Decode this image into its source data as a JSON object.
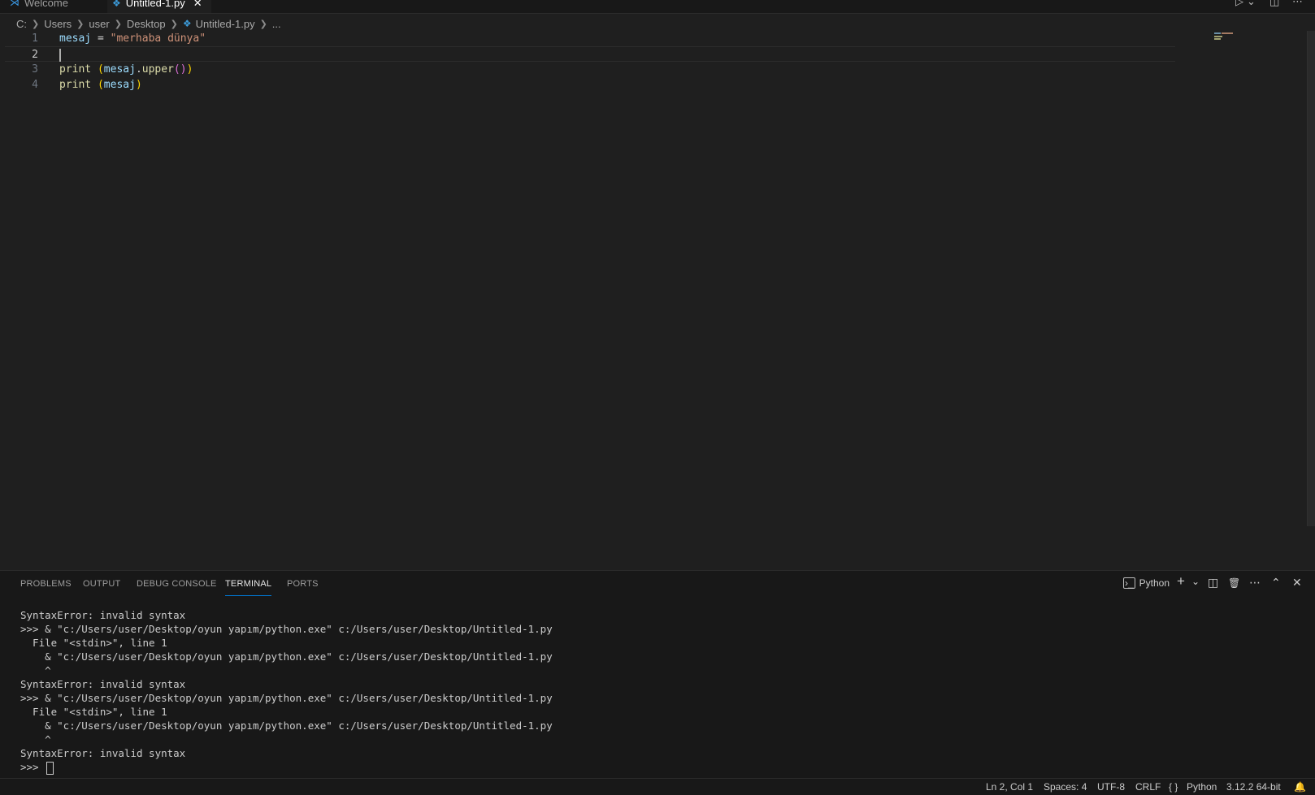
{
  "tabs": [
    {
      "label": "Welcome",
      "icon": "vscode-logo-icon"
    },
    {
      "label": "Untitled-1.py",
      "icon": "python-file-icon",
      "active": true,
      "close": "✕"
    }
  ],
  "titlebar_actions": {
    "run": "▷",
    "run_menu": "⌄",
    "split": "◫",
    "more": "⋯"
  },
  "breadcrumb": [
    "C:",
    "Users",
    "user",
    "Desktop",
    "Untitled-1.py",
    "..."
  ],
  "editor": {
    "lines": [
      {
        "num": "1",
        "tokens": [
          [
            "v",
            "mesaj"
          ],
          [
            "op",
            " = "
          ],
          [
            "s",
            "\"merhaba dünya\""
          ]
        ]
      },
      {
        "num": "2",
        "tokens": []
      },
      {
        "num": "3",
        "tokens": [
          [
            "f",
            "print"
          ],
          [
            "op",
            " "
          ],
          [
            "p1",
            "("
          ],
          [
            "v",
            "mesaj"
          ],
          [
            "op",
            "."
          ],
          [
            "f",
            "upper"
          ],
          [
            "p2",
            "()"
          ],
          [
            "p1",
            ")"
          ]
        ]
      },
      {
        "num": "4",
        "tokens": [
          [
            "f",
            "print"
          ],
          [
            "op",
            " "
          ],
          [
            "p1",
            "("
          ],
          [
            "v",
            "mesaj"
          ],
          [
            "p1",
            ")"
          ]
        ]
      }
    ],
    "active_line": "2"
  },
  "panel": {
    "tabs": [
      "PROBLEMS",
      "OUTPUT",
      "DEBUG CONSOLE",
      "TERMINAL",
      "PORTS"
    ],
    "active_tab": "TERMINAL",
    "terminal_profile": "Python",
    "actions": {
      "new": "+",
      "new_menu": "⌄",
      "split": "◫",
      "kill": "🗑",
      "more": "⋯",
      "maximize": "⌃",
      "close": "✕"
    },
    "terminal_lines": [
      "SyntaxError: invalid syntax",
      ">>> & \"c:/Users/user/Desktop/oyun yapım/python.exe\" c:/Users/user/Desktop/Untitled-1.py",
      "  File \"<stdin>\", line 1",
      "    & \"c:/Users/user/Desktop/oyun yapım/python.exe\" c:/Users/user/Desktop/Untitled-1.py",
      "    ^",
      "SyntaxError: invalid syntax",
      ">>> & \"c:/Users/user/Desktop/oyun yapım/python.exe\" c:/Users/user/Desktop/Untitled-1.py",
      "  File \"<stdin>\", line 1",
      "    & \"c:/Users/user/Desktop/oyun yapım/python.exe\" c:/Users/user/Desktop/Untitled-1.py",
      "    ^",
      "SyntaxError: invalid syntax"
    ],
    "prompt": ">>> "
  },
  "statusbar": {
    "position": "Ln 2, Col 1",
    "spaces": "Spaces: 4",
    "encoding": "UTF-8",
    "eol": "CRLF",
    "language": "Python",
    "interpreter": "3.12.2 64-bit",
    "bell": "🔔"
  }
}
